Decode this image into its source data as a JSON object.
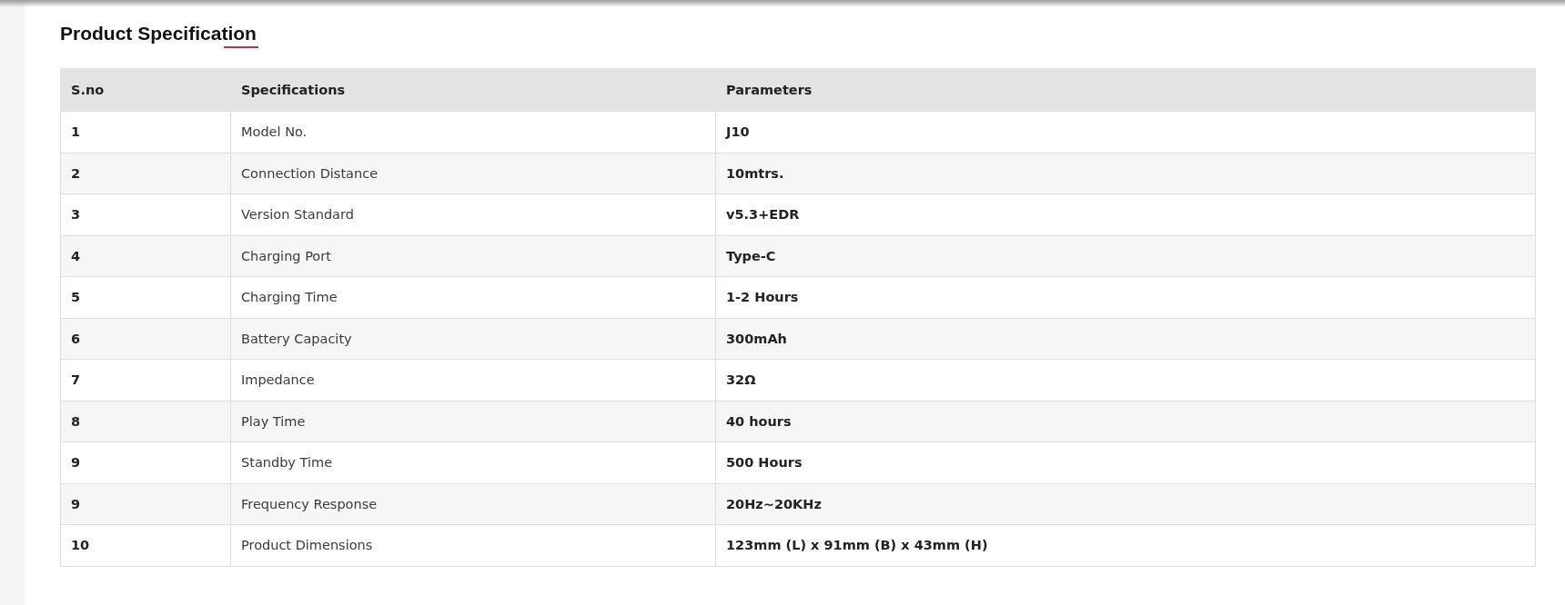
{
  "title": "Product Specification",
  "table": {
    "columns": [
      "S.no",
      "Specifications",
      "Parameters"
    ],
    "rows": [
      {
        "sno": "1",
        "spec": "Model No.",
        "param": "J10"
      },
      {
        "sno": "2",
        "spec": "Connection Distance",
        "param": "10mtrs."
      },
      {
        "sno": "3",
        "spec": "Version Standard",
        "param": "v5.3+EDR"
      },
      {
        "sno": "4",
        "spec": "Charging Port",
        "param": "Type-C"
      },
      {
        "sno": "5",
        "spec": "Charging Time",
        "param": "1-2 Hours"
      },
      {
        "sno": "6",
        "spec": "Battery Capacity",
        "param": "300mAh"
      },
      {
        "sno": "7",
        "spec": "Impedance",
        "param": "32Ω"
      },
      {
        "sno": "8",
        "spec": "Play Time",
        "param": "40 hours"
      },
      {
        "sno": "9",
        "spec": "Standby Time",
        "param": "500 Hours"
      },
      {
        "sno": "9",
        "spec": "Frequency Response",
        "param": "20Hz~20KHz"
      },
      {
        "sno": "10",
        "spec": "Product Dimensions",
        "param": "123mm (L) x 91mm (B) x 43mm (H)"
      }
    ]
  }
}
